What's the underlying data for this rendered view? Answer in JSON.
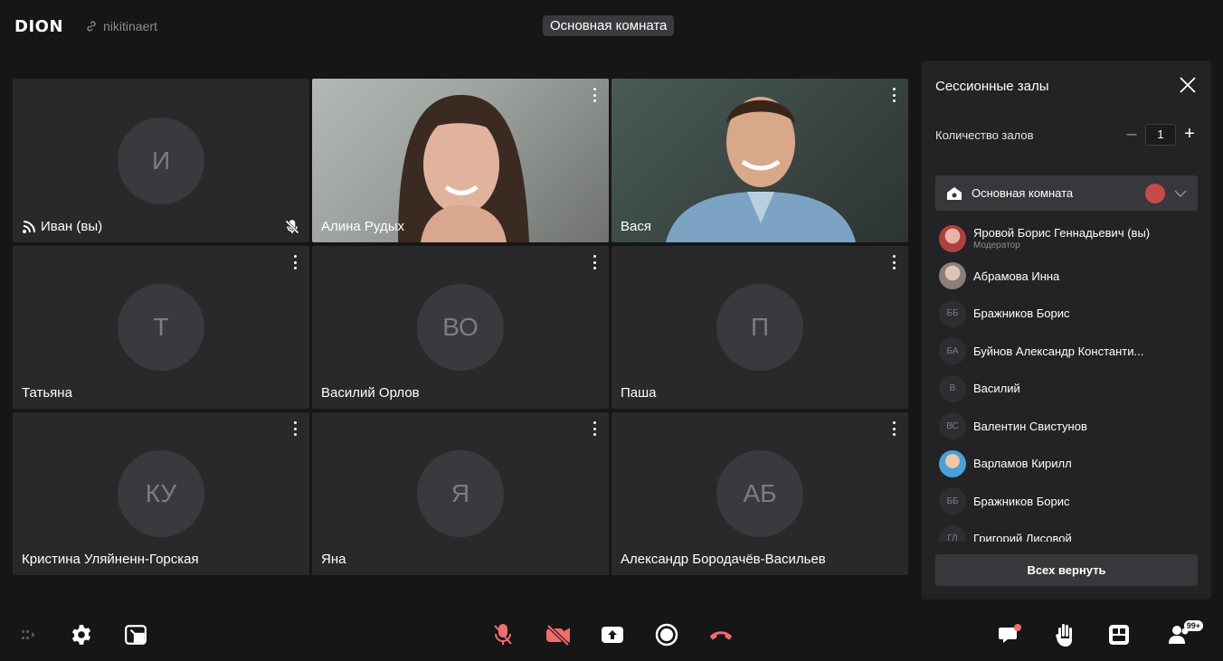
{
  "header": {
    "logo": "DION",
    "link_text": "nikitinaert",
    "room_title": "Основная комната"
  },
  "tiles": [
    {
      "initials": "И",
      "name": "Иван (вы)"
    },
    {
      "name": "Алина Рудых"
    },
    {
      "name": "Вася"
    },
    {
      "initials": "Т",
      "name": "Татьяна"
    },
    {
      "initials": "ВО",
      "name": "Василий Орлов"
    },
    {
      "initials": "П",
      "name": "Паша"
    },
    {
      "initials": "КУ",
      "name": "Кристина Уляйненн-Горская"
    },
    {
      "initials": "Я",
      "name": "Яна"
    },
    {
      "initials": "АБ",
      "name": "Александр Бородачёв-Васильев"
    }
  ],
  "panel": {
    "title": "Сессионные залы",
    "count_label": "Количество залов",
    "count_value": "1",
    "room_name": "Основная комната",
    "members": [
      {
        "initials": "",
        "name": "Яровой Борис Геннадьевич (вы)",
        "role": "Модератор"
      },
      {
        "initials": "",
        "name": "Абрамова Инна"
      },
      {
        "initials": "ББ",
        "name": "Бражников Борис"
      },
      {
        "initials": "БА",
        "name": "Буйнов Александр Константи..."
      },
      {
        "initials": "В",
        "name": "Василий"
      },
      {
        "initials": "ВС",
        "name": "Валентин Свистунов"
      },
      {
        "initials": "",
        "name": "Варламов Кирилл"
      },
      {
        "initials": "ББ",
        "name": "Бражников Борис"
      },
      {
        "initials": "ГЛ",
        "name": "Григорий Лисовой"
      }
    ],
    "return_button": "Всех вернуть"
  },
  "toolbar": {
    "participants_badge": "99+"
  },
  "colors": {
    "background": "#161618",
    "tile": "#29292c",
    "panel": "#232326",
    "danger": "#f06d6d"
  }
}
